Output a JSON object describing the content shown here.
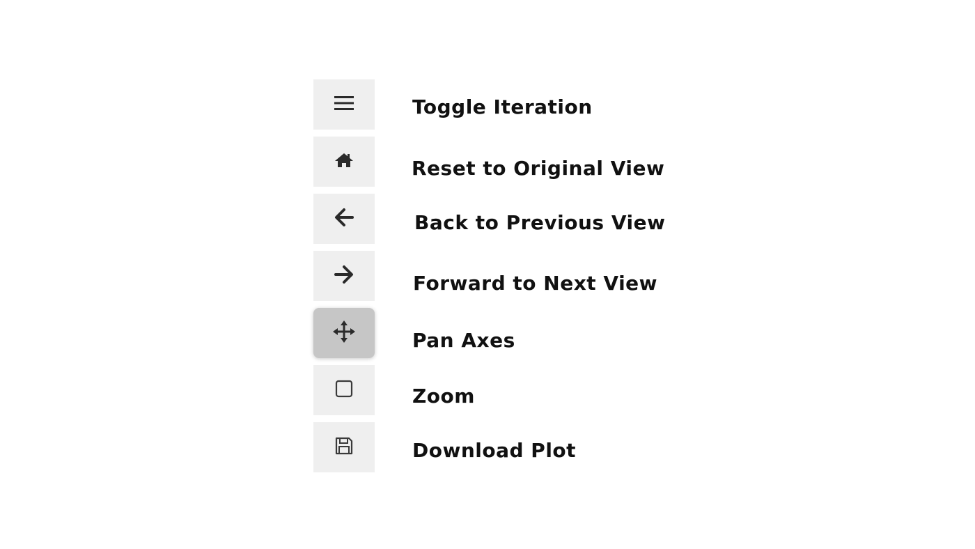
{
  "tools": [
    {
      "icon": "hamburger-menu-icon",
      "label": "Toggle Iteration",
      "active": false
    },
    {
      "icon": "home-icon",
      "label": "Reset to Original View",
      "active": false
    },
    {
      "icon": "arrow-left-icon",
      "label": "Back to Previous View",
      "active": false
    },
    {
      "icon": "arrow-right-icon",
      "label": "Forward to Next View",
      "active": false
    },
    {
      "icon": "move-arrows-icon",
      "label": "Pan Axes",
      "active": true
    },
    {
      "icon": "square-outline-icon",
      "label": "Zoom",
      "active": false
    },
    {
      "icon": "floppy-disk-icon",
      "label": "Download Plot",
      "active": false
    }
  ],
  "colors": {
    "button_bg": "#efefef",
    "button_active_bg": "#c6c6c6",
    "icon": "#2a2a2a",
    "label": "#111111"
  }
}
